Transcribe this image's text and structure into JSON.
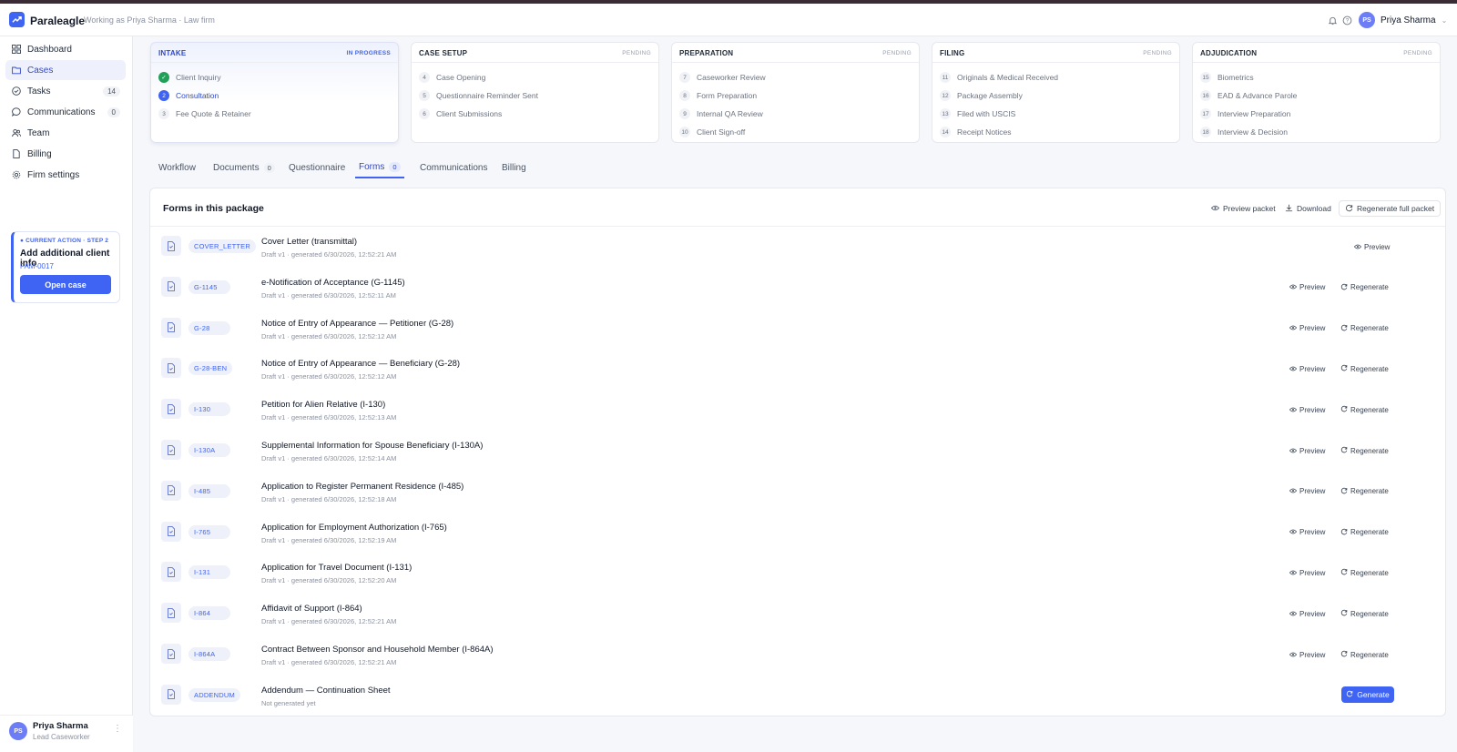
{
  "header": {
    "brand": "Paraleagle",
    "working_as": "Working as Priya Sharma · Law firm",
    "user_initials": "PS",
    "user_name": "Priya Sharma"
  },
  "sidebar": {
    "items": [
      {
        "label": "Dashboard",
        "icon": "grid-icon"
      },
      {
        "label": "Cases",
        "icon": "folder-icon"
      },
      {
        "label": "Tasks",
        "icon": "check-circle-icon",
        "count": "14"
      },
      {
        "label": "Communications",
        "icon": "chat-icon",
        "count": "0"
      },
      {
        "label": "Team",
        "icon": "users-icon"
      },
      {
        "label": "Billing",
        "icon": "document-icon"
      },
      {
        "label": "Firm settings",
        "icon": "gear-icon"
      }
    ],
    "current_action": {
      "tag": "CURRENT ACTION · STEP 2",
      "title": "Add additional client info",
      "case_id": "FAM-0017",
      "button": "Open case"
    },
    "footer": {
      "initials": "PS",
      "name": "Priya Sharma",
      "role": "Lead Caseworker"
    }
  },
  "stages": [
    {
      "title": "INTAKE",
      "status": "IN PROGRESS",
      "steps": [
        {
          "num": "",
          "label": "Client Inquiry",
          "state": "done"
        },
        {
          "num": "2",
          "label": "Consultation",
          "state": "current"
        },
        {
          "num": "3",
          "label": "Fee Quote & Retainer",
          "state": "pending"
        }
      ]
    },
    {
      "title": "CASE SETUP",
      "status": "PENDING",
      "steps": [
        {
          "num": "4",
          "label": "Case Opening",
          "state": "pending"
        },
        {
          "num": "5",
          "label": "Questionnaire Reminder Sent",
          "state": "pending"
        },
        {
          "num": "6",
          "label": "Client Submissions",
          "state": "pending"
        }
      ]
    },
    {
      "title": "PREPARATION",
      "status": "PENDING",
      "steps": [
        {
          "num": "7",
          "label": "Caseworker Review",
          "state": "pending"
        },
        {
          "num": "8",
          "label": "Form Preparation",
          "state": "pending"
        },
        {
          "num": "9",
          "label": "Internal QA Review",
          "state": "pending"
        },
        {
          "num": "10",
          "label": "Client Sign-off",
          "state": "pending"
        }
      ]
    },
    {
      "title": "FILING",
      "status": "PENDING",
      "steps": [
        {
          "num": "11",
          "label": "Originals & Medical Received",
          "state": "pending"
        },
        {
          "num": "12",
          "label": "Package Assembly",
          "state": "pending"
        },
        {
          "num": "13",
          "label": "Filed with USCIS",
          "state": "pending"
        },
        {
          "num": "14",
          "label": "Receipt Notices",
          "state": "pending"
        }
      ]
    },
    {
      "title": "ADJUDICATION",
      "status": "PENDING",
      "steps": [
        {
          "num": "15",
          "label": "Biometrics",
          "state": "pending"
        },
        {
          "num": "16",
          "label": "EAD & Advance Parole",
          "state": "pending"
        },
        {
          "num": "17",
          "label": "Interview Preparation",
          "state": "pending"
        },
        {
          "num": "18",
          "label": "Interview & Decision",
          "state": "pending"
        }
      ]
    }
  ],
  "tabs": [
    {
      "label": "Workflow"
    },
    {
      "label": "Documents",
      "count": "0"
    },
    {
      "label": "Questionnaire"
    },
    {
      "label": "Forms",
      "count": "0",
      "active": true
    },
    {
      "label": "Communications"
    },
    {
      "label": "Billing"
    }
  ],
  "panel": {
    "title": "Forms in this package",
    "preview_packet": "Preview packet",
    "download": "Download",
    "regenerate_full": "Regenerate full packet",
    "preview_label": "Preview",
    "regenerate_label": "Regenerate",
    "generate_label": "Generate"
  },
  "forms": [
    {
      "code": "COVER_LETTER",
      "name": "Cover Letter (transmittal)",
      "meta": "Draft v1 · generated 6/30/2026, 12:52:21 AM",
      "actions": "preview"
    },
    {
      "code": "G-1145",
      "name": "e-Notification of Acceptance (G-1145)",
      "meta": "Draft v1 · generated 6/30/2026, 12:52:11 AM",
      "actions": "both"
    },
    {
      "code": "G-28",
      "name": "Notice of Entry of Appearance — Petitioner (G-28)",
      "meta": "Draft v1 · generated 6/30/2026, 12:52:12 AM",
      "actions": "both"
    },
    {
      "code": "G-28-BEN",
      "name": "Notice of Entry of Appearance — Beneficiary (G-28)",
      "meta": "Draft v1 · generated 6/30/2026, 12:52:12 AM",
      "actions": "both"
    },
    {
      "code": "I-130",
      "name": "Petition for Alien Relative (I-130)",
      "meta": "Draft v1 · generated 6/30/2026, 12:52:13 AM",
      "actions": "both"
    },
    {
      "code": "I-130A",
      "name": "Supplemental Information for Spouse Beneficiary (I-130A)",
      "meta": "Draft v1 · generated 6/30/2026, 12:52:14 AM",
      "actions": "both"
    },
    {
      "code": "I-485",
      "name": "Application to Register Permanent Residence (I-485)",
      "meta": "Draft v1 · generated 6/30/2026, 12:52:18 AM",
      "actions": "both"
    },
    {
      "code": "I-765",
      "name": "Application for Employment Authorization (I-765)",
      "meta": "Draft v1 · generated 6/30/2026, 12:52:19 AM",
      "actions": "both"
    },
    {
      "code": "I-131",
      "name": "Application for Travel Document (I-131)",
      "meta": "Draft v1 · generated 6/30/2026, 12:52:20 AM",
      "actions": "both"
    },
    {
      "code": "I-864",
      "name": "Affidavit of Support (I-864)",
      "meta": "Draft v1 · generated 6/30/2026, 12:52:21 AM",
      "actions": "both"
    },
    {
      "code": "I-864A",
      "name": "Contract Between Sponsor and Household Member (I-864A)",
      "meta": "Draft v1 · generated 6/30/2026, 12:52:21 AM",
      "actions": "both"
    },
    {
      "code": "ADDENDUM",
      "name": "Addendum — Continuation Sheet",
      "meta": "Not generated yet",
      "actions": "generate"
    }
  ],
  "colors": {
    "accent": "#3f63f2",
    "done": "#22a05a",
    "topbar": "#3a2b35"
  }
}
